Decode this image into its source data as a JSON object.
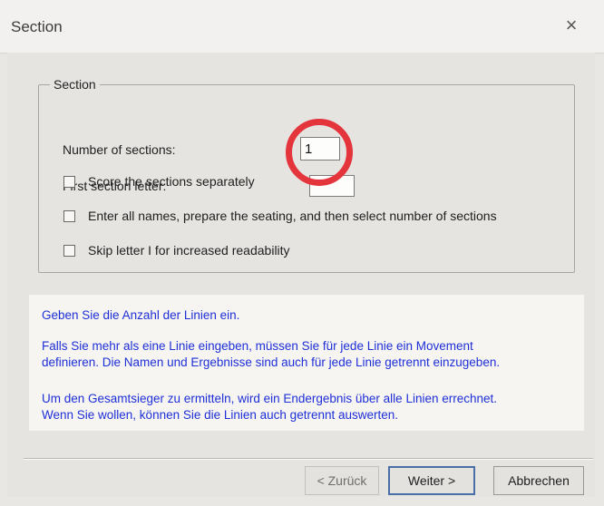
{
  "window": {
    "title": "Section",
    "close_glyph": "×"
  },
  "section_group": {
    "legend": "Section",
    "number_label": "Number of sections:",
    "number_value": "1",
    "first_letter_label": "First section letter:",
    "first_letter_value": "",
    "checkboxes": [
      {
        "label": "Score the sections separately",
        "checked": false
      },
      {
        "label": "Enter all names, prepare the seating, and then select number of sections",
        "checked": false
      },
      {
        "label": "Skip letter I for increased readability",
        "checked": false
      }
    ]
  },
  "info": {
    "line1": "Geben Sie die Anzahl der Linien ein.",
    "line2": "Falls Sie mehr als eine Linie eingeben, müssen Sie für jede Linie ein Movement",
    "line3": "definieren. Die Namen und Ergebnisse sind auch für jede Linie getrennt einzugeben.",
    "line4": "Um den Gesamtsieger zu ermitteln, wird ein Endergebnis über alle Linien errechnet.",
    "line5": "Wenn Sie wollen, können Sie die Linien auch getrennt auswerten.",
    "text_color": "#1f2fd8"
  },
  "buttons": {
    "back": "< Zurück",
    "next": "Weiter >",
    "cancel": "Abbrechen"
  },
  "annotation": {
    "color": "#e4343c",
    "shape": "circle"
  }
}
